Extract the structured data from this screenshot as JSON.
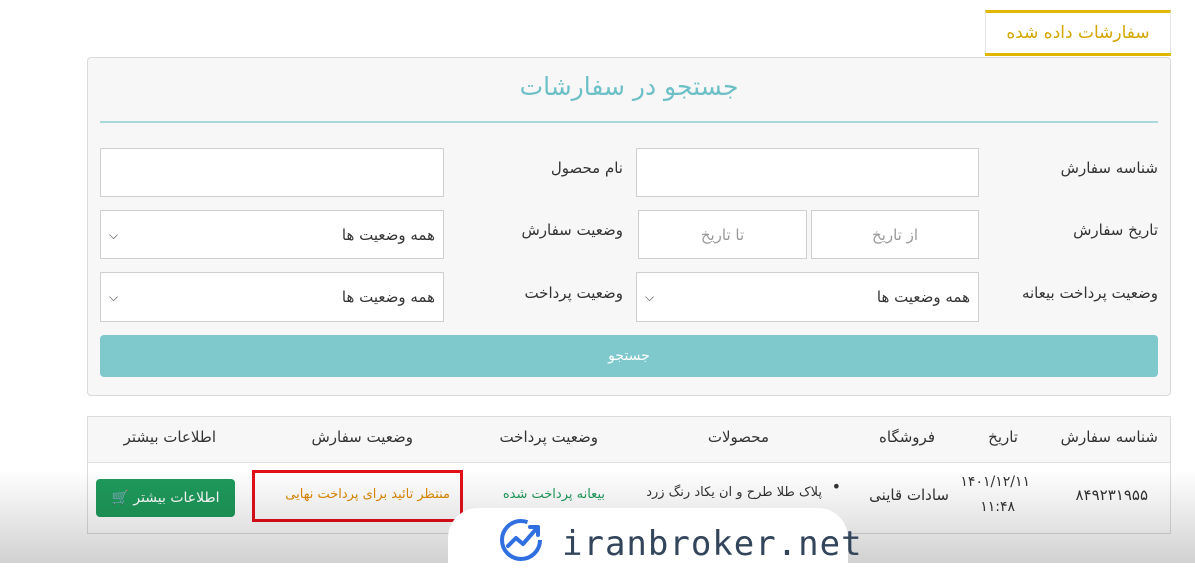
{
  "tab": {
    "label": "سفارشات داده شده"
  },
  "search": {
    "title": "جستجو در سفارشات",
    "order_id_label": "شناسه سفارش",
    "product_name_label": "نام محصول",
    "order_date_label": "تاریخ سفارش",
    "from_date_placeholder": "از تاریخ",
    "to_date_placeholder": "تا تاریخ",
    "order_status_label": "وضعیت سفارش",
    "order_status_value": "همه وضعیت ها",
    "prepayment_status_label": "وضعیت پرداخت بیعانه",
    "prepayment_status_value": "همه وضعیت ها",
    "payment_status_label": "وضعیت پرداخت",
    "payment_status_value": "همه وضعیت ها",
    "button_label": "جستجو"
  },
  "table": {
    "headers": [
      "شناسه سفارش",
      "تاریخ",
      "فروشگاه",
      "محصولات",
      "وضعیت پرداخت",
      "وضعیت سفارش",
      "اطلاعات بیشتر"
    ],
    "rows": [
      {
        "order_id": "۸۴۹۲۳۱۹۵۵",
        "date": "۱۴۰۱/۱۲/۱۱",
        "time": "۱۱:۴۸",
        "store": "سادات قاینی",
        "product": "پلاک طلا طرح و ان یکاد رنگ زرد",
        "payment_status": "بیعانه پرداخت شده",
        "order_status": "منتظر تائید برای پرداخت نهایی",
        "more_button": "اطلاعات بیشتر"
      }
    ]
  },
  "watermark": {
    "text": "iranbroker.net"
  },
  "colors": {
    "accent_yellow": "#e0b800",
    "teal": "#7fc8cb",
    "green": "#1e9a5b",
    "orange_status": "#e08a00",
    "highlight_red": "#e3101a"
  },
  "icons": [
    "chevron-down-icon",
    "cart-icon",
    "bullet-icon",
    "watermark-logo-icon"
  ]
}
